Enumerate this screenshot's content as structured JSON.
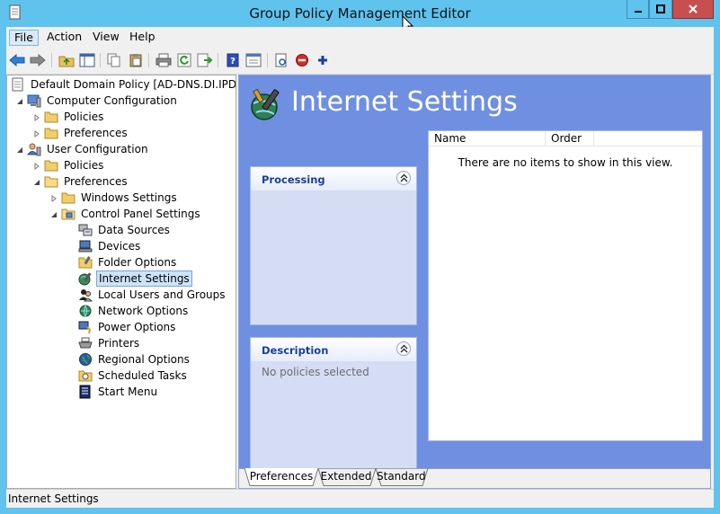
{
  "window": {
    "title": "Group Policy Management Editor"
  },
  "menu": {
    "file": "File",
    "action": "Action",
    "view": "View",
    "help": "Help"
  },
  "toolbar": {
    "icons": [
      "back-arrow-icon",
      "forward-arrow-icon",
      "up-folder-icon",
      "show-hide-tree-icon",
      "copy-icon",
      "paste-icon",
      "print-icon",
      "refresh-icon",
      "export-list-icon",
      "help-icon",
      "properties-icon",
      "test-icon",
      "stop-icon",
      "add-icon"
    ]
  },
  "tree": {
    "root": "Default Domain Policy [AD-DNS.DI.IPDR] P",
    "computer_config": "Computer Configuration",
    "cc_policies": "Policies",
    "cc_preferences": "Preferences",
    "user_config": "User Configuration",
    "uc_policies": "Policies",
    "uc_preferences": "Preferences",
    "windows_settings": "Windows Settings",
    "control_panel_settings": "Control Panel Settings",
    "items": [
      "Data Sources",
      "Devices",
      "Folder Options",
      "Internet Settings",
      "Local Users and Groups",
      "Network Options",
      "Power Options",
      "Printers",
      "Regional Options",
      "Scheduled Tasks",
      "Start Menu"
    ],
    "selected": "Internet Settings"
  },
  "main": {
    "heading": "Internet Settings",
    "processing_title": "Processing",
    "description_title": "Description",
    "description_text": "No policies selected",
    "columns": [
      "Name",
      "Order"
    ],
    "empty_text": "There are no items to show in this view."
  },
  "tabs": [
    "Preferences",
    "Extended",
    "Standard"
  ],
  "status": {
    "text": "Internet Settings"
  },
  "colors": {
    "titlebar": "#5fc3ee",
    "close": "#c7504f",
    "pane_blue": "#6f8fe1",
    "panel_title": "#1a3f9b",
    "selection": "#cce4f7"
  }
}
